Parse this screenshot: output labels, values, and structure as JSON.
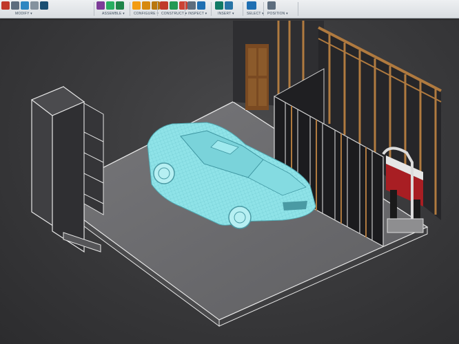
{
  "toolbar": {
    "groups": [
      {
        "label": "MODIFY ▾",
        "icons": [
          "push-pull-icon",
          "fillet-icon",
          "chamfer-icon",
          "shell-icon"
        ]
      },
      {
        "label": "ASSEMBLE ▾",
        "icons": [
          "new-component-icon",
          "joint-icon",
          "as-built-joint-icon"
        ]
      },
      {
        "label": "CONSTRUCT ▾",
        "icons": [
          "offset-plane-icon",
          "plane-at-angle-icon",
          "midplane-icon"
        ]
      },
      {
        "label": "INSPECT ▾",
        "icons": [
          "measure-icon",
          "section-analysis-icon"
        ]
      },
      {
        "label": "INSERT ▾",
        "icons": [
          "insert-derive-icon",
          "insert-image-icon"
        ]
      },
      {
        "label": "SELECT ▾",
        "icons": [
          "select-arrow-icon"
        ]
      },
      {
        "label": "POSITION ▾",
        "icons": [
          "capture-position-icon"
        ]
      }
    ],
    "colors": {
      "accent": "#1f6fb2",
      "label": "#3a4a5a"
    }
  },
  "model": {
    "car_color": "#8fe3e8",
    "floor_color": "#6c6c6e",
    "wall_color": "#2b2b2e",
    "stud_color": "#b07a3f"
  }
}
